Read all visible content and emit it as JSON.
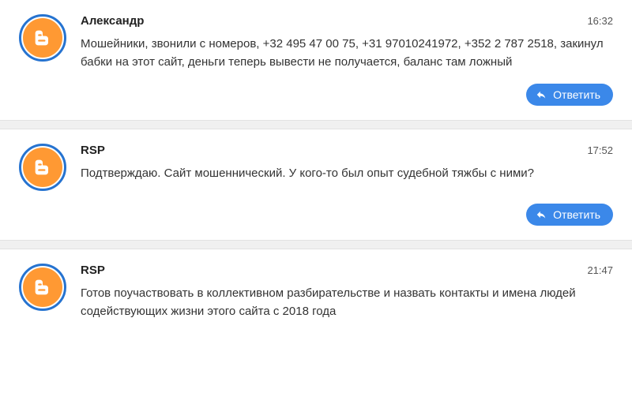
{
  "reply_label": "Ответить",
  "comments": [
    {
      "author": "Александр",
      "time": "16:32",
      "text": "Мошейники, звонили с номеров, +32 495 47 00 75, +31 97010241972, +352 2 787 2518, закинул бабки на этот сайт, деньги теперь вывести не получается, баланс там ложный",
      "show_reply": true
    },
    {
      "author": "RSP",
      "time": "17:52",
      "text": "Подтверждаю. Сайт мошеннический. У кого-то был опыт судебной тяжбы с ними?",
      "show_reply": true
    },
    {
      "author": "RSP",
      "time": "21:47",
      "text": "Готов поучаствовать в коллективном разбирательстве и назвать контакты и имена людей содействующих жизни этого сайта с 2018 года",
      "show_reply": false
    }
  ]
}
